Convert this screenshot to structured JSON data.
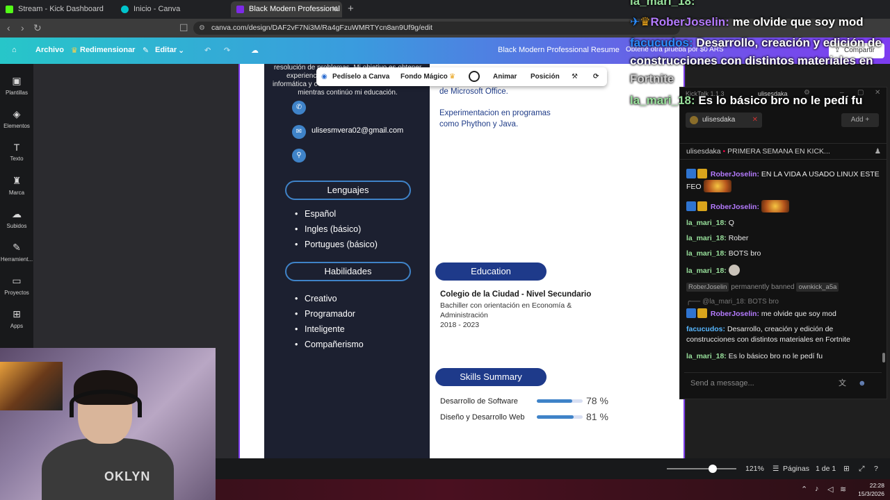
{
  "browser": {
    "tabs": [
      {
        "label": "Stream - Kick Dashboard",
        "favicon_color": "#53fc18"
      },
      {
        "label": "Inicio - Canva",
        "favicon_color": "#00c4cc"
      },
      {
        "label": "Black Modern Professional Resu",
        "favicon_color": "#7d2ae8"
      }
    ],
    "url": "canva.com/design/DAF2vF7Ni3M/Ra4gFzuWMRTYcn8an9Uf9g/edit"
  },
  "canva_toolbar": {
    "archivo": "Archivo",
    "redimensionar": "Redimensionar",
    "editar": "Editar",
    "doc_title": "Black Modern Professional Resume",
    "trial": "Obtené otra prueba por $0 ARS",
    "share": "Compartir"
  },
  "sidebar": [
    {
      "label": "Plantillas",
      "icon": "template-icon"
    },
    {
      "label": "Elementos",
      "icon": "elements-icon"
    },
    {
      "label": "Texto",
      "icon": "text-icon"
    },
    {
      "label": "Marca",
      "icon": "brand-icon"
    },
    {
      "label": "Subidos",
      "icon": "upload-icon"
    },
    {
      "label": "Herramient...",
      "icon": "tools-icon"
    },
    {
      "label": "Proyectos",
      "icon": "folder-icon"
    },
    {
      "label": "Apps",
      "icon": "apps-icon"
    }
  ],
  "context_bar": {
    "ask": "Pedíselo a Canva",
    "magic_bg": "Fondo Mágico",
    "animate": "Animar",
    "position": "Posición"
  },
  "resume": {
    "intro_lines": [
      "resolución de problemas. Mi objetivo es obtener",
      "experienc",
      "informática y c",
      "mientras continúo mi educación."
    ],
    "email": "ulisesmvera02@gmail.com",
    "languages_heading": "Lenguajes",
    "languages": [
      "Español",
      "Ingles (básico)",
      "Portugues (básico)"
    ],
    "skills_heading": "Habilidades",
    "skills": [
      "Creativo",
      "Programador",
      "Inteligente",
      "Compañerismo"
    ],
    "right_top": [
      "de Microsoft Office.",
      "Experimentacion en programas",
      "como Phython y Java."
    ],
    "education_heading": "Education",
    "education": {
      "title": "Colegio de la Ciudad - Nivel Secundario",
      "line1": "Bachiller con orientación en Economía &",
      "line2": "Administración",
      "years": "2018 - 2023"
    },
    "skills_summary_heading": "Skills Summary",
    "skill_bars": [
      {
        "label": "Desarrollo de Software",
        "value": 78,
        "text": "78 %"
      },
      {
        "label": "Diseño y Desarrollo Web",
        "value": 81,
        "text": "81 %"
      }
    ]
  },
  "bottom_bar": {
    "zoom": "121%",
    "pages_label": "Páginas",
    "page_count": "1 de 1"
  },
  "taskbar": {
    "time": "22:28",
    "date": "15/3/2026"
  },
  "overlay": [
    {
      "name": "la_mari_18:",
      "msg": "",
      "name_class": "nm-g"
    },
    {
      "name": "RoberJoselin:",
      "msg": "me olvide que soy mod",
      "name_class": "nm-p"
    },
    {
      "name": "facucudos:",
      "msg": "Desarrollo, creación y edición de",
      "name_class": "nm-b"
    },
    {
      "name": "",
      "msg": "construcciones con distintos materiales en",
      "name_class": ""
    },
    {
      "name": "",
      "msg": "Fortnite",
      "name_class": ""
    },
    {
      "name": "la_mari_18:",
      "msg": "Es lo básico bro no le pedí fu",
      "name_class": "nm-g"
    }
  ],
  "kicktalk": {
    "title": "KickTalk 1.1.3",
    "user": "ulisesdaka",
    "chip": "ulisesdaka",
    "add": "Add",
    "stream_info": "PRIMERA SEMANA EN KICK...",
    "stream_user": "ulisesdaka",
    "messages": [
      {
        "name": "RoberJoselin:",
        "text": "EN LA VIDA A USADO LINUX ESTE FEO"
      },
      {
        "name": "RoberJoselin:",
        "text": ""
      },
      {
        "name": "la_mari_18:",
        "text": "Q"
      },
      {
        "name": "la_mari_18:",
        "text": "Rober"
      },
      {
        "name": "la_mari_18:",
        "text": "BOTS bro"
      },
      {
        "name": "la_mari_18:",
        "text": ""
      },
      {
        "name": "RoberJoselin",
        "text": "permanently banned",
        "target": "ownkick_a5a"
      },
      {
        "name": "@la_mari_18:",
        "text": "BOTS bro"
      },
      {
        "name": "RoberJoselin:",
        "text": "me olvide que soy mod"
      },
      {
        "name": "facucudos:",
        "text": "Desarrollo, creación y edición de construcciones con distintos materiales en Fortnite"
      },
      {
        "name": "la_mari_18:",
        "text": "Es lo básico bro no le pedí fu"
      }
    ],
    "send_placeholder": "Send a message..."
  },
  "webcam": {
    "shirt_text": "OKLYN"
  }
}
